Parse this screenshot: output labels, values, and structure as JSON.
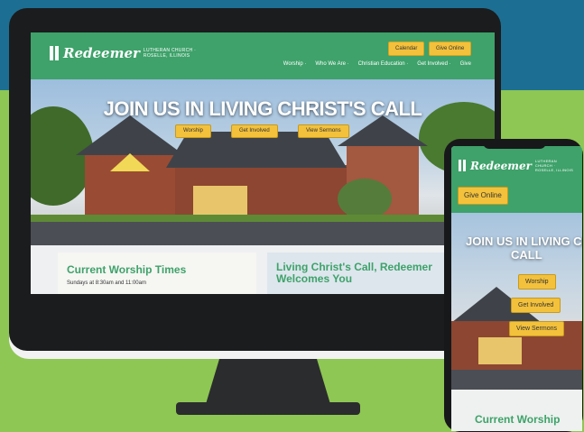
{
  "colors": {
    "brand_green": "#3ea26a",
    "button_yellow": "#f3c13b",
    "backdrop_blue": "#1c6f93",
    "backdrop_green": "#8ec753"
  },
  "desktop": {
    "logo": {
      "name": "Redeemer",
      "subtitle": "LUTHERAN CHURCH · ROSELLE, ILLINOIS"
    },
    "header_buttons": {
      "calendar": "Calendar",
      "give_online": "Give Online"
    },
    "nav": [
      "Worship ·",
      "Who We Are ·",
      "Christian Education ·",
      "Get Involved ·",
      "Give"
    ],
    "hero": {
      "title": "JOIN US IN LIVING CHRIST'S CALL",
      "buttons": [
        "Worship",
        "Get Involved",
        "View Sermons"
      ]
    },
    "cards": [
      {
        "title": "Current Worship Times",
        "text": "Sundays at 8:30am and 11:00am"
      },
      {
        "title": "Living Christ's Call, Redeemer Welcomes You"
      }
    ]
  },
  "mobile": {
    "logo": {
      "name": "Redeemer",
      "subtitle": "LUTHERAN CHURCH · ROSELLE, ILLINOIS"
    },
    "give_online": "Give Online",
    "hero": {
      "title_line1": "JOIN US IN LIVING CHRI",
      "title_line2": "CALL",
      "buttons": [
        "Worship",
        "Get Involved",
        "View Sermons"
      ]
    },
    "card_title": "Current Worship"
  }
}
